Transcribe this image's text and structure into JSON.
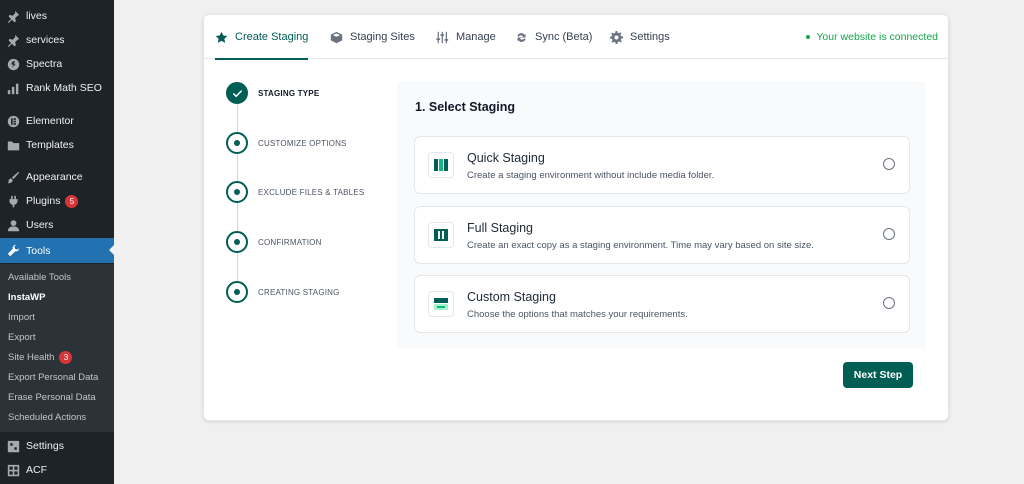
{
  "sidebar": {
    "items": [
      {
        "label": "lives",
        "icon": "pin-icon"
      },
      {
        "label": "services",
        "icon": "pin-icon"
      },
      {
        "label": "Spectra",
        "icon": "spectra-icon"
      },
      {
        "label": "Rank Math SEO",
        "icon": "chart-icon"
      },
      {
        "label": "Elementor",
        "icon": "elementor-icon"
      },
      {
        "label": "Templates",
        "icon": "folder-icon"
      },
      {
        "label": "Appearance",
        "icon": "brush-icon"
      },
      {
        "label": "Plugins",
        "icon": "plug-icon",
        "badge": "5"
      },
      {
        "label": "Users",
        "icon": "user-icon"
      },
      {
        "label": "Tools",
        "icon": "wrench-icon"
      },
      {
        "label": "Settings",
        "icon": "settings-icon"
      },
      {
        "label": "ACF",
        "icon": "grid-icon"
      }
    ],
    "submenu": [
      {
        "label": "Available Tools"
      },
      {
        "label": "InstaWP"
      },
      {
        "label": "Import"
      },
      {
        "label": "Export"
      },
      {
        "label": "Site Health",
        "badge": "3"
      },
      {
        "label": "Export Personal Data"
      },
      {
        "label": "Erase Personal Data"
      },
      {
        "label": "Scheduled Actions"
      }
    ]
  },
  "tabs": [
    {
      "label": "Create Staging",
      "icon": "star-icon"
    },
    {
      "label": "Staging Sites",
      "icon": "cube-icon"
    },
    {
      "label": "Manage",
      "icon": "sliders-icon"
    },
    {
      "label": "Sync (Beta)",
      "icon": "sync-icon"
    },
    {
      "label": "Settings",
      "icon": "gear-icon"
    }
  ],
  "status": "Your website is connected",
  "steps": [
    {
      "label": "STAGING TYPE",
      "state": "done"
    },
    {
      "label": "CUSTOMIZE OPTIONS",
      "state": "pending"
    },
    {
      "label": "EXCLUDE FILES & TABLES",
      "state": "pending"
    },
    {
      "label": "CONFIRMATION",
      "state": "pending"
    },
    {
      "label": "CREATING STAGING",
      "state": "pending"
    }
  ],
  "panel": {
    "title": "1. Select Staging",
    "options": [
      {
        "title": "Quick Staging",
        "desc": "Create a staging environment without include media folder.",
        "icon": "quick-staging-icon"
      },
      {
        "title": "Full Staging",
        "desc": "Create an exact copy as a staging environment. Time may vary based on site size.",
        "icon": "full-staging-icon"
      },
      {
        "title": "Custom Staging",
        "desc": "Choose the options that matches your requirements.",
        "icon": "custom-staging-icon"
      }
    ]
  },
  "next_button": "Next Step",
  "colors": {
    "accent": "#005e54",
    "connected": "#16a34a",
    "wp_active": "#2271b1",
    "sidebar": "#1d2327"
  }
}
